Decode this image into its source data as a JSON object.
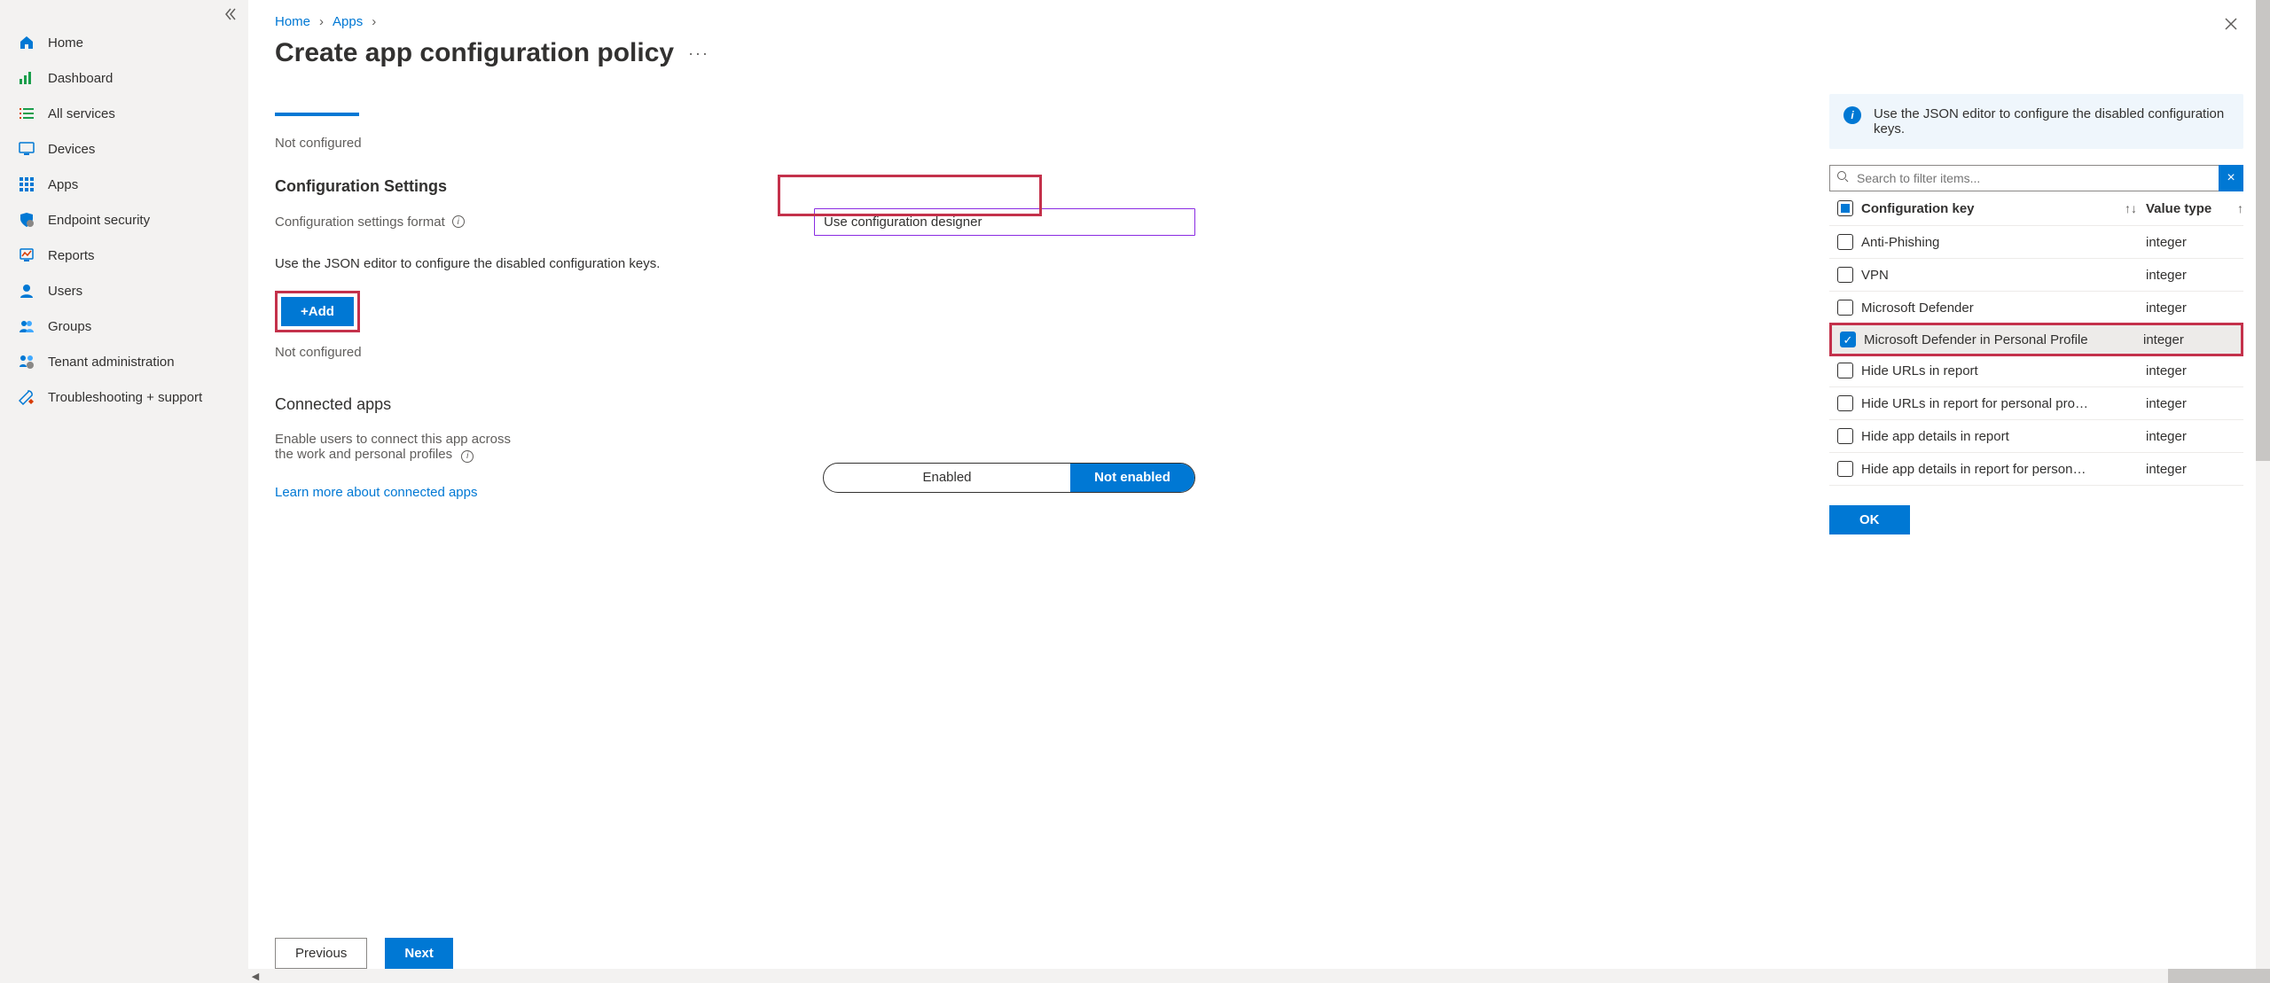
{
  "sidebar": {
    "items": [
      {
        "label": "Home",
        "icon": "home"
      },
      {
        "label": "Dashboard",
        "icon": "dashboard"
      },
      {
        "label": "All services",
        "icon": "list"
      },
      {
        "label": "Devices",
        "icon": "monitor"
      },
      {
        "label": "Apps",
        "icon": "grid"
      },
      {
        "label": "Endpoint security",
        "icon": "shield"
      },
      {
        "label": "Reports",
        "icon": "reports"
      },
      {
        "label": "Users",
        "icon": "user"
      },
      {
        "label": "Groups",
        "icon": "group"
      },
      {
        "label": "Tenant administration",
        "icon": "tenant"
      },
      {
        "label": "Troubleshooting + support",
        "icon": "wrench"
      }
    ]
  },
  "breadcrumb": {
    "home": "Home",
    "apps": "Apps"
  },
  "page_title": "Create app configuration policy",
  "status_not_configured": "Not configured",
  "section_config_settings": "Configuration Settings",
  "field_format_label": "Configuration settings format",
  "field_format_value": "Use configuration designer",
  "json_hint": "Use the JSON editor to configure the disabled configuration keys.",
  "add_btn": "+Add",
  "connected_apps_h": "Connected apps",
  "connected_apps_desc": "Enable users to connect this app across the work and personal profiles",
  "segmented_enabled": "Enabled",
  "segmented_not": "Not enabled",
  "learn_more": "Learn more about connected apps",
  "footer_prev": "Previous",
  "footer_next": "Next",
  "panel": {
    "info": "Use the JSON editor to configure the disabled configuration keys.",
    "search_placeholder": "Search to filter items...",
    "col_key": "Configuration key",
    "col_val": "Value type",
    "ok": "OK",
    "rows": [
      {
        "key": "Anti-Phishing",
        "type": "integer",
        "checked": false
      },
      {
        "key": "VPN",
        "type": "integer",
        "checked": false
      },
      {
        "key": "Microsoft Defender",
        "type": "integer",
        "checked": false
      },
      {
        "key": "Microsoft Defender in Personal Profile",
        "type": "integer",
        "checked": true,
        "highlight": true
      },
      {
        "key": "Hide URLs in report",
        "type": "integer",
        "checked": false
      },
      {
        "key": "Hide URLs in report for personal profile",
        "type": "integer",
        "checked": false
      },
      {
        "key": "Hide app details in report",
        "type": "integer",
        "checked": false
      },
      {
        "key": "Hide app details in report for personal profile",
        "type": "integer",
        "checked": false
      }
    ]
  }
}
